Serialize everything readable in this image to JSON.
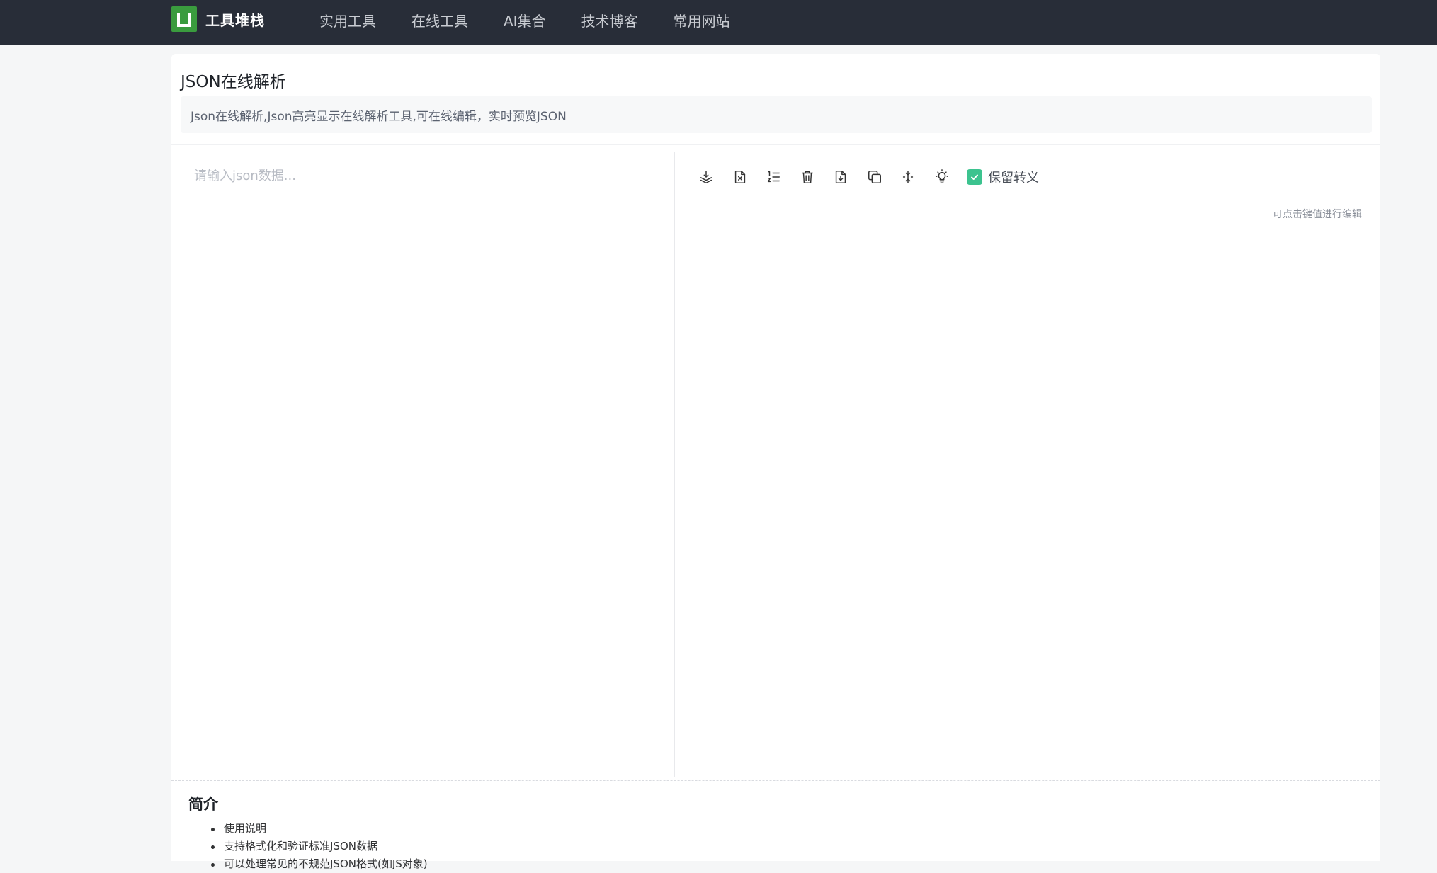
{
  "brand": {
    "name": "工具堆栈"
  },
  "nav": {
    "items": [
      {
        "label": "实用工具"
      },
      {
        "label": "在线工具"
      },
      {
        "label": "AI集合"
      },
      {
        "label": "技术博客"
      },
      {
        "label": "常用网站"
      }
    ]
  },
  "page": {
    "title": "JSON在线解析",
    "description": "Json在线解析,Json高亮显示在线解析工具,可在线编辑，实时预览JSON"
  },
  "editor": {
    "placeholder": "请输入json数据..."
  },
  "toolbar": {
    "icons": [
      "format-icon",
      "clear-file-icon",
      "line-numbers-icon",
      "delete-icon",
      "download-icon",
      "copy-icon",
      "compress-icon",
      "theme-icon"
    ],
    "keep_escape_label": "保留转义",
    "keep_escape_checked": true
  },
  "output": {
    "hint": "可点击键值进行编辑"
  },
  "intro": {
    "title": "简介",
    "items": [
      "使用说明",
      "支持格式化和验证标准JSON数据",
      "可以处理常见的不规范JSON格式(如JS对象)"
    ]
  },
  "colors": {
    "topbar": "#282d38",
    "brand_logo": "#3a9b3e",
    "checkbox": "#3cc38f",
    "background": "#f5f6f7"
  }
}
